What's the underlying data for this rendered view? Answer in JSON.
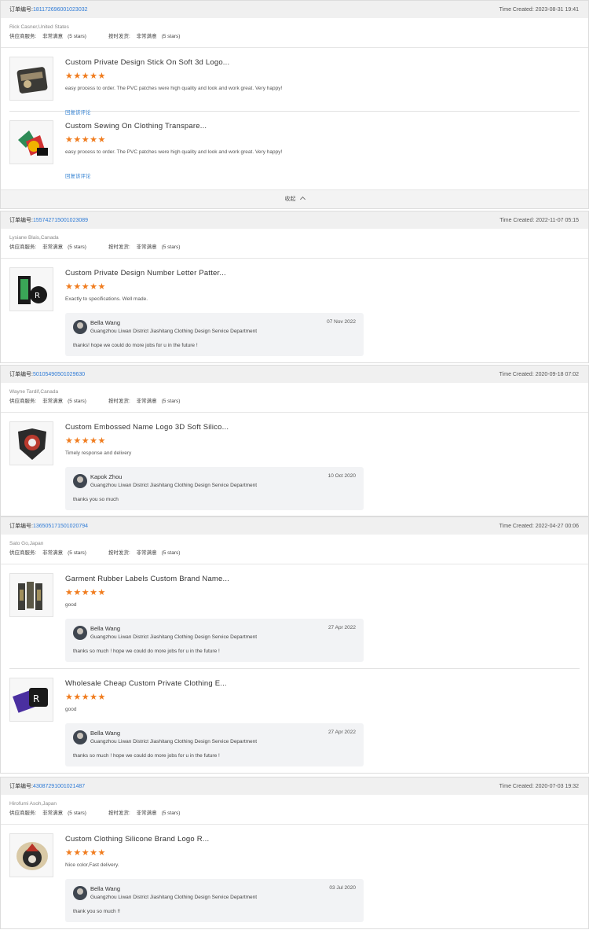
{
  "labels": {
    "order_prefix": "订单编号:",
    "time_prefix": "Time Created: ",
    "supplier_service": "供应商服务: ",
    "on_time": "按时发货: ",
    "rating_value": "非常满意",
    "stars_text": "(5 stars)",
    "collapse": "收起",
    "reply_link": "回复该评论",
    "star_glyphs": "★★★★★"
  },
  "orders": [
    {
      "order_number": "181172696001023032",
      "time_created": "2023-08-31 19:41",
      "buyer": "Rick Casner,United States",
      "items": [
        {
          "title": "Custom Private Design Stick On Soft 3d Logo...",
          "review": "easy process to order. The PVC patches were high quality and look and work great. Very happy!"
        },
        {
          "title": "Custom Sewing On Clothing Transpare...",
          "review": "easy process to order. The PVC patches were high quality and look and work great. Very happy!"
        }
      ]
    },
    {
      "order_number": "155742715001023089",
      "time_created": "2022-11-07 05:15",
      "buyer": "Lysiane Blais,Canada",
      "items": [
        {
          "title": "Custom Private Design Number Letter Patter...",
          "review": "Exactly to specifications. Well made.",
          "reply": {
            "name": "Bella Wang",
            "date": "07 Nov 2022",
            "company": "Guangzhou Liwan District Jiashitang Clothing Design Service Department",
            "text": "thanks! hope we could do more jobs for u in the future !"
          }
        }
      ]
    },
    {
      "order_number": "50105490501029630",
      "time_created": "2020-09-18 07:02",
      "buyer": "Wayne Tardif,Canada",
      "items": [
        {
          "title": "Custom Embossed Name Logo 3D Soft Silico...",
          "review": "Timely response and delivery",
          "reply": {
            "name": "Kapok Zhou",
            "date": "10 Oct 2020",
            "company": "Guangzhou Liwan District Jiashitang Clothing Design Service Department",
            "text": "thanks you so much"
          }
        }
      ]
    },
    {
      "order_number": "136505171501020794",
      "time_created": "2022-04-27 00:06",
      "buyer": "Sato Go,Japan",
      "items": [
        {
          "title": "Garment Rubber Labels Custom Brand Name...",
          "review": "good",
          "reply": {
            "name": "Bella Wang",
            "date": "27 Apr 2022",
            "company": "Guangzhou Liwan District Jiashitang Clothing Design Service Department",
            "text": "thanks so much ! hope we could do more jobs for u in the future !"
          }
        },
        {
          "title": "Wholesale Cheap Custom Private Clothing E...",
          "review": "good",
          "reply": {
            "name": "Bella Wang",
            "date": "27 Apr 2022",
            "company": "Guangzhou Liwan District Jiashitang Clothing Design Service Department",
            "text": "thanks so much ! hope we could do more jobs for u in the future !"
          }
        }
      ]
    },
    {
      "order_number": "43087291001021487",
      "time_created": "2020-07-03 19:32",
      "buyer": "Hirofumi Asoh,Japan",
      "items": [
        {
          "title": "Custom Clothing Silicone Brand Logo R...",
          "review": "Nice color,Fast delivery.",
          "reply": {
            "name": "Bella Wang",
            "date": "03 Jul 2020",
            "company": "Guangzhou Liwan District Jiashitang Clothing Design Service Department",
            "text": "thank you so much !!"
          }
        }
      ]
    }
  ]
}
